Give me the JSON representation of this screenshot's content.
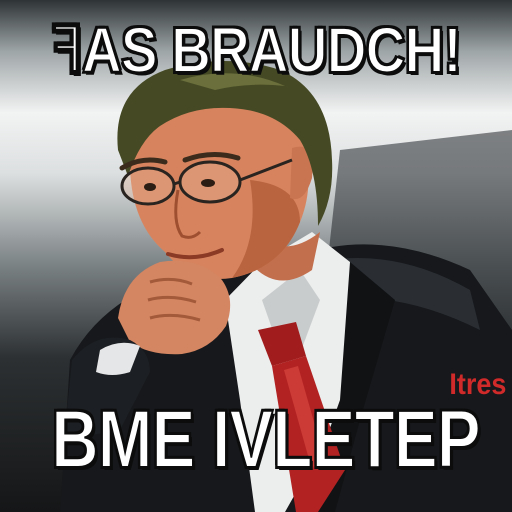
{
  "captions": {
    "top": "ꟻAS BRAUDCH!",
    "bottom": "BME IVLETEP",
    "side_tag": "Itres"
  },
  "colors": {
    "caption_fill": "#ffffff",
    "caption_outline": "#0c0c0c",
    "side_tag": "#d12a2a",
    "tie": "#b22222",
    "suit": "#16181b",
    "hair": "#454a25",
    "skin": "#d7845e"
  }
}
